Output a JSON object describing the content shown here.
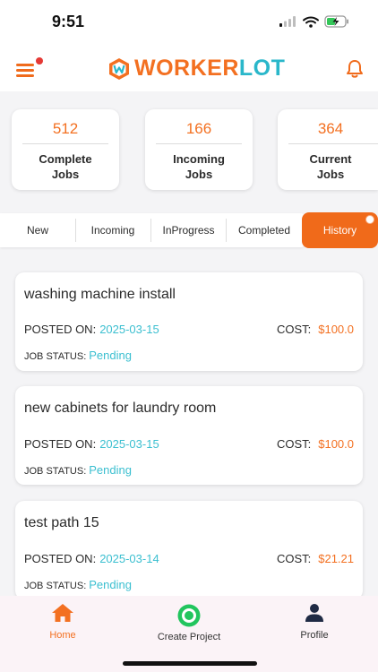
{
  "status_bar": {
    "time": "9:51"
  },
  "header": {
    "logo_part1": "WORKER",
    "logo_part2": "LOT",
    "menu_icon": "hamburger-menu-icon",
    "bell_icon": "bell-icon",
    "accent_color": "#f37021",
    "teal_color": "#2ab7ca"
  },
  "stats": [
    {
      "value": "512",
      "label": "Complete Jobs"
    },
    {
      "value": "166",
      "label": "Incoming Jobs"
    },
    {
      "value": "364",
      "label": "Current Jobs"
    }
  ],
  "tabs": [
    {
      "label": "New"
    },
    {
      "label": "Incoming"
    },
    {
      "label": "InProgress"
    },
    {
      "label": "Completed"
    },
    {
      "label": "History",
      "active": true
    }
  ],
  "jobs": [
    {
      "title": "washing machine install",
      "posted_label": "POSTED ON:",
      "posted_date": "2025-03-15",
      "cost_label": "COST:",
      "cost": "$100.0",
      "status_label": "JOB STATUS:",
      "status": "Pending"
    },
    {
      "title": "new cabinets for laundry room",
      "posted_label": "POSTED ON:",
      "posted_date": "2025-03-15",
      "cost_label": "COST:",
      "cost": "$100.0",
      "status_label": "JOB STATUS:",
      "status": "Pending"
    },
    {
      "title": "test path 15",
      "posted_label": "POSTED ON:",
      "posted_date": "2025-03-14",
      "cost_label": "COST:",
      "cost": "$21.21",
      "status_label": "JOB STATUS:",
      "status": "Pending"
    }
  ],
  "bottom_nav": [
    {
      "label": "Home",
      "icon": "home-icon",
      "active": true
    },
    {
      "label": "Create Project",
      "icon": "create-project-icon"
    },
    {
      "label": "Profile",
      "icon": "profile-icon"
    }
  ]
}
